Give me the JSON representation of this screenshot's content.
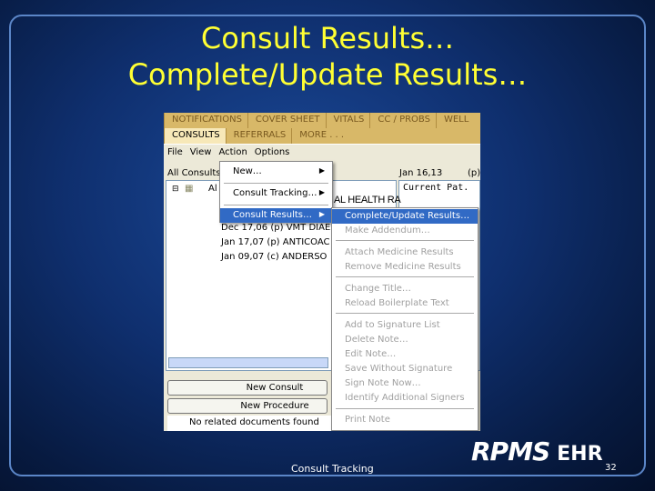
{
  "slide": {
    "title_line1": "Consult Results…",
    "title_line2": "Complete/Update Results…",
    "footer": "Consult Tracking",
    "page": "32",
    "logo": "RPMS EHR"
  },
  "tabs_row1": [
    "NOTIFICATIONS",
    "COVER SHEET",
    "VITALS",
    "CC / PROBS",
    "WELL"
  ],
  "tabs_row2": [
    "CONSULTS",
    "REFERRALS",
    "MORE . . ."
  ],
  "menu": [
    "File",
    "View",
    "Action",
    "Options"
  ],
  "list_header": "All Consults",
  "date_header": "Jan 16,13",
  "date_status": "(p)",
  "detail_text": "Current Pat.",
  "tree_root": "Al",
  "partial_row": "AL HEALTH RA",
  "consults": [
    {
      "date": "Dec 17,06",
      "status": "(p)",
      "name": "VMT DIAE"
    },
    {
      "date": "Jan 17,07",
      "status": "(p)",
      "name": "ANTICOAC"
    },
    {
      "date": "Jan 09,07",
      "status": "(c)",
      "name": "ANDERSO"
    }
  ],
  "action_menu": [
    "New…",
    "Consult Tracking…",
    "Consult Results…"
  ],
  "results_submenu": {
    "selected": "Complete/Update Results…",
    "groups": [
      [
        "Complete/Update Results…",
        "Make Addendum…"
      ],
      [
        "Attach Medicine Results",
        "Remove Medicine Results"
      ],
      [
        "Change Title…",
        "Reload Boilerplate Text"
      ],
      [
        "Add to Signature List",
        "Delete Note…",
        "Edit Note…",
        "Save Without Signature",
        "Sign Note Now…",
        "Identify Additional Signers"
      ],
      [
        "Print Note"
      ]
    ]
  },
  "buttons": {
    "new_consult": "New Consult",
    "new_procedure": "New Procedure"
  },
  "related": "No related documents found",
  "colors": {
    "title": "#ffff33",
    "selection": "#316ac5",
    "tab": "#d8b868"
  }
}
